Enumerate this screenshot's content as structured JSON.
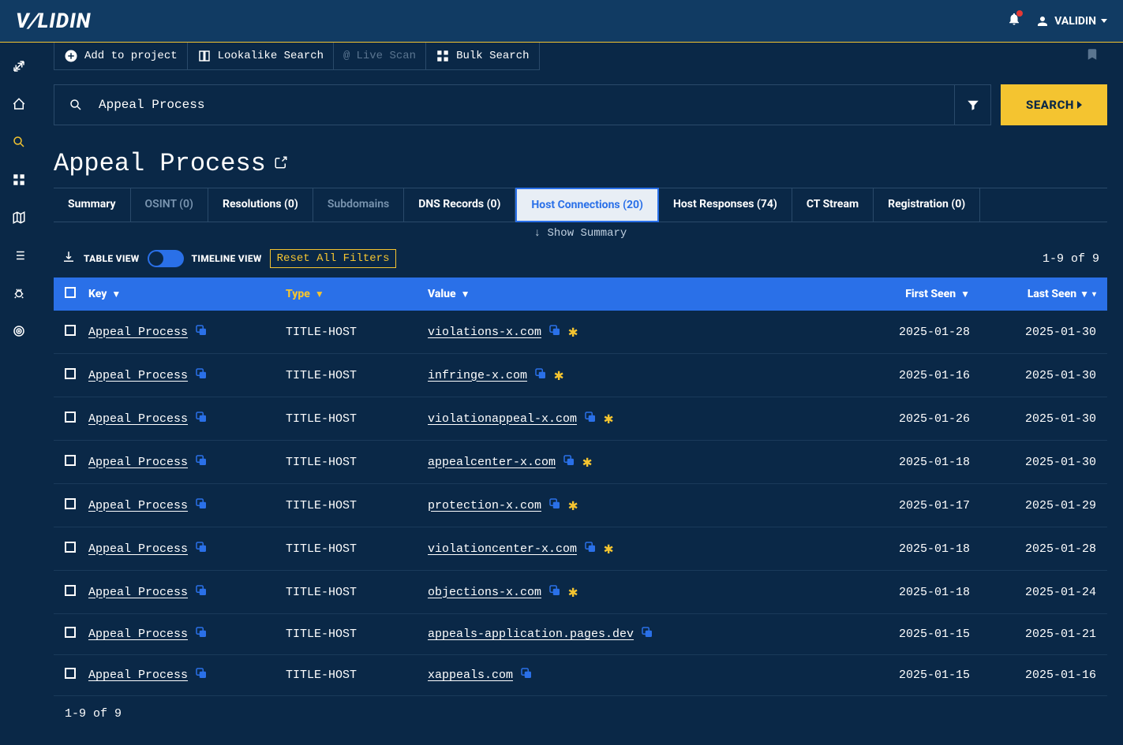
{
  "header": {
    "logo": "VALIDIN",
    "user": "VALIDIN"
  },
  "toolbar": {
    "add_project": "Add to project",
    "lookalike": "Lookalike Search",
    "live_scan": "Live Scan",
    "bulk_search": "Bulk Search"
  },
  "search": {
    "value": "Appeal Process",
    "button": "SEARCH"
  },
  "page_title": "Appeal Process",
  "tabs": [
    {
      "label": "Summary",
      "muted": false
    },
    {
      "label": "OSINT (0)",
      "muted": true
    },
    {
      "label": "Resolutions (0)",
      "muted": false
    },
    {
      "label": "Subdomains",
      "muted": true
    },
    {
      "label": "DNS Records (0)",
      "muted": false
    },
    {
      "label": "Host Connections (20)",
      "active": true
    },
    {
      "label": "Host Responses (74)",
      "muted": false
    },
    {
      "label": "CT Stream",
      "muted": false
    },
    {
      "label": "Registration (0)",
      "muted": false
    }
  ],
  "show_summary": "Show Summary",
  "view": {
    "table": "TABLE VIEW",
    "timeline": "TIMELINE VIEW",
    "reset": "Reset All Filters",
    "pagination": "1-9 of 9"
  },
  "table": {
    "headers": {
      "key": "Key",
      "type": "Type",
      "value": "Value",
      "first_seen": "First Seen",
      "last_seen": "Last Seen"
    },
    "rows": [
      {
        "key": "Appeal Process",
        "type": "TITLE-HOST",
        "value": "violations-x.com",
        "star": true,
        "first": "2025-01-28",
        "last": "2025-01-30"
      },
      {
        "key": "Appeal Process",
        "type": "TITLE-HOST",
        "value": "infringe-x.com",
        "star": true,
        "first": "2025-01-16",
        "last": "2025-01-30"
      },
      {
        "key": "Appeal Process",
        "type": "TITLE-HOST",
        "value": "violationappeal-x.com",
        "star": true,
        "first": "2025-01-26",
        "last": "2025-01-30"
      },
      {
        "key": "Appeal Process",
        "type": "TITLE-HOST",
        "value": "appealcenter-x.com",
        "star": true,
        "first": "2025-01-18",
        "last": "2025-01-30"
      },
      {
        "key": "Appeal Process",
        "type": "TITLE-HOST",
        "value": "protection-x.com",
        "star": true,
        "first": "2025-01-17",
        "last": "2025-01-29"
      },
      {
        "key": "Appeal Process",
        "type": "TITLE-HOST",
        "value": "violationcenter-x.com",
        "star": true,
        "first": "2025-01-18",
        "last": "2025-01-28"
      },
      {
        "key": "Appeal Process",
        "type": "TITLE-HOST",
        "value": "objections-x.com",
        "star": true,
        "first": "2025-01-18",
        "last": "2025-01-24"
      },
      {
        "key": "Appeal Process",
        "type": "TITLE-HOST",
        "value": "appeals-application.pages.dev",
        "star": false,
        "first": "2025-01-15",
        "last": "2025-01-21"
      },
      {
        "key": "Appeal Process",
        "type": "TITLE-HOST",
        "value": "xappeals.com",
        "star": false,
        "first": "2025-01-15",
        "last": "2025-01-16"
      }
    ]
  },
  "footer_pagination": "1-9 of 9"
}
